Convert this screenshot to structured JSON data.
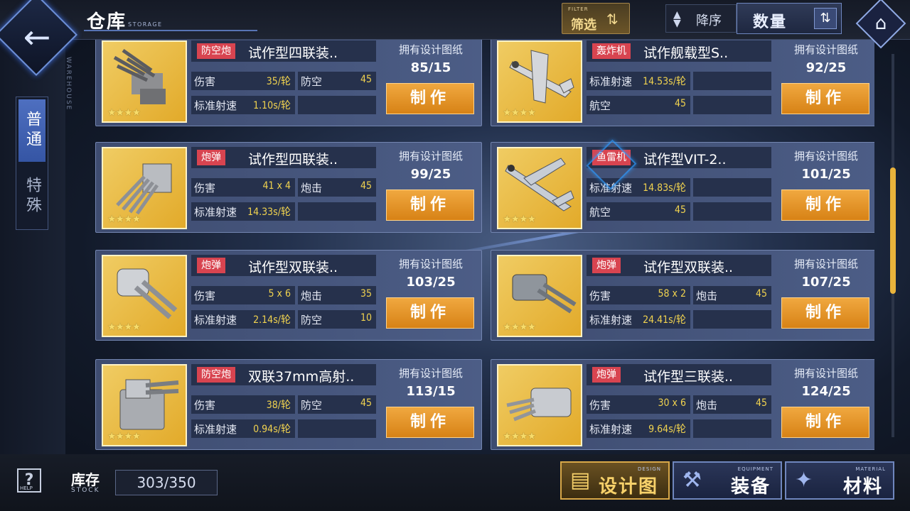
{
  "header": {
    "title": "仓库",
    "title_sub": "STORAGE",
    "rail_vertical": "WAREHOUSE"
  },
  "toolbar": {
    "filter_sub": "FILTER",
    "filter_label": "筛选",
    "sort_order": "降序",
    "sort_key": "数量"
  },
  "tabs": [
    "普通",
    "特殊"
  ],
  "blueprint_label": "拥有设计图纸",
  "make_label": "制作",
  "stars": "★★★★",
  "items": [
    {
      "tag": "防空炮",
      "name": "试作型四联装..",
      "icon": "aa-gun-quad-icon",
      "stats": [
        [
          "伤害",
          "35/轮"
        ],
        [
          "防空",
          "45"
        ],
        [
          "标准射速",
          "1.10s/轮"
        ],
        [
          "",
          ""
        ]
      ],
      "count": "85/15"
    },
    {
      "tag": "轰炸机",
      "name": "试作舰载型S..",
      "icon": "dive-bomber-plane-icon",
      "stats": [
        [
          "标准射速",
          "14.53s/轮"
        ],
        [
          "",
          ""
        ],
        [
          "航空",
          "45"
        ],
        [
          "",
          ""
        ]
      ],
      "count": "92/25"
    },
    {
      "tag": "炮弹",
      "name": "试作型四联装..",
      "icon": "quad-gun-turret-icon",
      "stats": [
        [
          "伤害",
          "41 x 4"
        ],
        [
          "炮击",
          "45"
        ],
        [
          "标准射速",
          "14.33s/轮"
        ],
        [
          "",
          ""
        ]
      ],
      "count": "99/25"
    },
    {
      "tag": "鱼雷机",
      "name": "试作型VIT-2..",
      "icon": "torpedo-bomber-plane-icon",
      "stats": [
        [
          "标准射速",
          "14.83s/轮"
        ],
        [
          "",
          ""
        ],
        [
          "航空",
          "45"
        ],
        [
          "",
          ""
        ]
      ],
      "count": "101/25"
    },
    {
      "tag": "炮弹",
      "name": "试作型双联装..",
      "icon": "twin-gun-turret-icon",
      "stats": [
        [
          "伤害",
          "5 x 6"
        ],
        [
          "炮击",
          "35"
        ],
        [
          "标准射速",
          "2.14s/轮"
        ],
        [
          "防空",
          "10"
        ]
      ],
      "count": "103/25"
    },
    {
      "tag": "炮弹",
      "name": "试作型双联装..",
      "icon": "twin-gun-turret-large-icon",
      "stats": [
        [
          "伤害",
          "58 x 2"
        ],
        [
          "炮击",
          "45"
        ],
        [
          "标准射速",
          "24.41s/轮"
        ],
        [
          "",
          ""
        ]
      ],
      "count": "107/25"
    },
    {
      "tag": "防空炮",
      "name": "双联37mm高射..",
      "icon": "twin-aa-gun-icon",
      "stats": [
        [
          "伤害",
          "38/轮"
        ],
        [
          "防空",
          "45"
        ],
        [
          "标准射速",
          "0.94s/轮"
        ],
        [
          "",
          ""
        ]
      ],
      "count": "113/15"
    },
    {
      "tag": "炮弹",
      "name": "试作型三联装..",
      "icon": "triple-gun-turret-icon",
      "stats": [
        [
          "伤害",
          "30 x 6"
        ],
        [
          "炮击",
          "45"
        ],
        [
          "标准射速",
          "9.64s/轮"
        ],
        [
          "",
          ""
        ]
      ],
      "count": "124/25"
    }
  ],
  "bottom": {
    "help_sub": "HELP",
    "stock_label": "库存",
    "stock_sub": "STOCK",
    "stock_value": "303/350",
    "nav": [
      {
        "label": "设计图",
        "sub": "DESIGN",
        "icon": "blueprint-icon",
        "active": true
      },
      {
        "label": "装备",
        "sub": "EQUIPMENT",
        "icon": "equipment-icon",
        "active": false
      },
      {
        "label": "材料",
        "sub": "MATERIAL",
        "icon": "material-icon",
        "active": false
      }
    ]
  }
}
